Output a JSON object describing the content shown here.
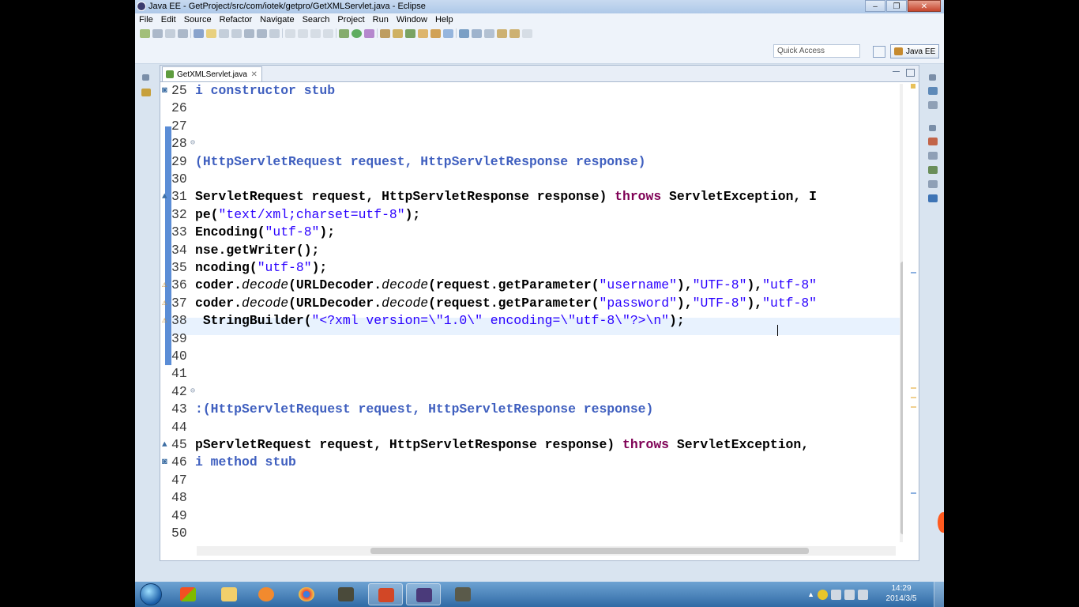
{
  "window": {
    "title": "Java EE - GetProject/src/com/iotek/getpro/GetXMLServlet.java - Eclipse",
    "minimize_label": "‒",
    "maximize_label": "❐",
    "close_label": "✕"
  },
  "menu": [
    {
      "label": "File"
    },
    {
      "label": "Edit"
    },
    {
      "label": "Source"
    },
    {
      "label": "Refactor"
    },
    {
      "label": "Navigate"
    },
    {
      "label": "Search"
    },
    {
      "label": "Project"
    },
    {
      "label": "Run"
    },
    {
      "label": "Window"
    },
    {
      "label": "Help"
    }
  ],
  "quick_access": {
    "placeholder": "Quick Access"
  },
  "perspective": {
    "label": "Java EE"
  },
  "editor": {
    "tab_label": "GetXMLServlet.java",
    "tab_close": "✕"
  },
  "code_lines": [
    {
      "num": "25",
      "marker": "◙",
      "html": "<span class=\"cmt bold\">i constructor stub</span>"
    },
    {
      "num": "26",
      "marker": "",
      "html": ""
    },
    {
      "num": "27",
      "marker": "",
      "html": ""
    },
    {
      "num": "28",
      "marker": "",
      "html": "",
      "fold": "⊖"
    },
    {
      "num": "29",
      "marker": "",
      "html": "<span class=\"cmt bold\">(HttpServletRequest request, HttpServletResponse response)</span>"
    },
    {
      "num": "30",
      "marker": "",
      "html": ""
    },
    {
      "num": "31",
      "marker": "▲",
      "html": "<span class=\"bold\">ServletRequest request, HttpServletResponse response) </span><span class=\"kw\">throws</span><span class=\"bold\"> ServletException, I</span>"
    },
    {
      "num": "32",
      "marker": "",
      "html": "<span class=\"bold\">pe(</span><span class=\"str\">\"text/xml;charset=utf-8\"</span><span class=\"bold\">);</span>"
    },
    {
      "num": "33",
      "marker": "",
      "html": "<span class=\"bold\">Encoding(</span><span class=\"str\">\"utf-8\"</span><span class=\"bold\">);</span>"
    },
    {
      "num": "34",
      "marker": "",
      "html": "<span class=\"bold\">nse.getWriter();</span>"
    },
    {
      "num": "35",
      "marker": "",
      "html": "<span class=\"bold\">ncoding(</span><span class=\"str\">\"utf-8\"</span><span class=\"bold\">);</span>"
    },
    {
      "num": "36",
      "marker": "⚠",
      "html": "<span class=\"bold\">coder.</span><span class=\"it\">decode</span><span class=\"bold\">(URLDecoder.</span><span class=\"it\">decode</span><span class=\"bold\">(request.getParameter(</span><span class=\"str\">\"username\"</span><span class=\"bold\">),</span><span class=\"str\">\"UTF-8\"</span><span class=\"bold\">),</span><span class=\"str\">\"utf-8\"</span>"
    },
    {
      "num": "37",
      "marker": "⚠",
      "html": "<span class=\"bold\">coder.</span><span class=\"it\">decode</span><span class=\"bold\">(URLDecoder.</span><span class=\"it\">decode</span><span class=\"bold\">(request.getParameter(</span><span class=\"str\">\"password\"</span><span class=\"bold\">),</span><span class=\"str\">\"UTF-8\"</span><span class=\"bold\">),</span><span class=\"str\">\"utf-8\"</span>"
    },
    {
      "num": "38",
      "marker": "⚠",
      "html": "<span class=\"bold\"> StringBuilder(</span><span class=\"str\">\"&lt;?xml version=\\\"1.0\\\" encoding=\\\"utf-8\\\"?&gt;\\n\"</span><span class=\"bold\">);</span>"
    },
    {
      "num": "39",
      "marker": "",
      "html": ""
    },
    {
      "num": "40",
      "marker": "",
      "html": ""
    },
    {
      "num": "41",
      "marker": "",
      "html": ""
    },
    {
      "num": "42",
      "marker": "",
      "html": "",
      "fold": "⊖"
    },
    {
      "num": "43",
      "marker": "",
      "html": "<span class=\"cmt bold\">:(HttpServletRequest request, HttpServletResponse response)</span>"
    },
    {
      "num": "44",
      "marker": "",
      "html": ""
    },
    {
      "num": "45",
      "marker": "▲",
      "html": "<span class=\"bold\">pServletRequest request, HttpServletResponse response) </span><span class=\"kw\">throws</span><span class=\"bold\"> ServletException,</span>"
    },
    {
      "num": "46",
      "marker": "◙",
      "html": "<span class=\"cmt bold\">i method stub</span>"
    },
    {
      "num": "47",
      "marker": "",
      "html": ""
    },
    {
      "num": "48",
      "marker": "",
      "html": ""
    },
    {
      "num": "49",
      "marker": "",
      "html": ""
    },
    {
      "num": "50",
      "marker": "",
      "html": ""
    }
  ],
  "clock": {
    "time": "14:29",
    "date": "2014/3/5"
  },
  "colors": {
    "accent": "#2a00ff",
    "keyword": "#7f0055",
    "fold_bar": "#5b8dd6"
  }
}
